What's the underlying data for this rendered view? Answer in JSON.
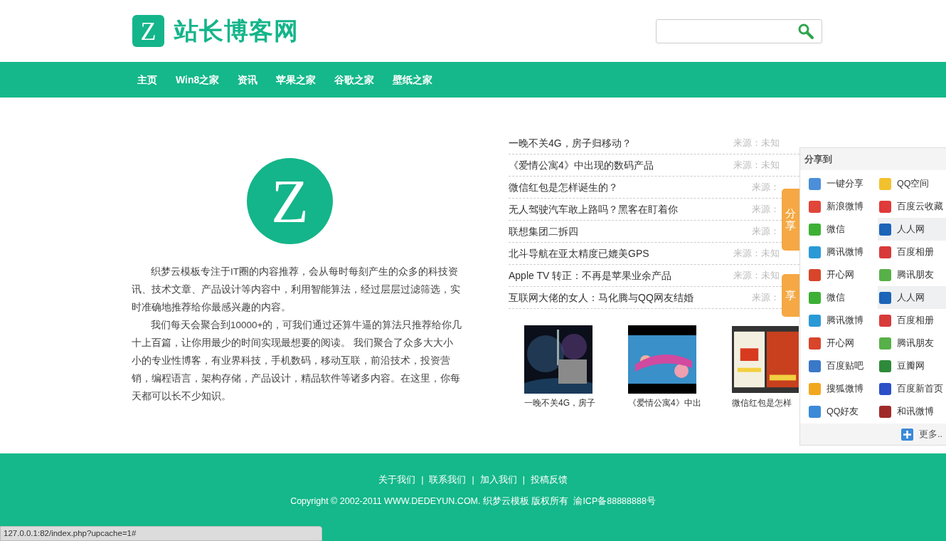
{
  "header": {
    "logo_letter": "Z",
    "site_name": "站长博客网"
  },
  "nav": [
    {
      "label": "主页"
    },
    {
      "label": "Win8之家"
    },
    {
      "label": "资讯"
    },
    {
      "label": "苹果之家"
    },
    {
      "label": "谷歌之家"
    },
    {
      "label": "壁纸之家"
    }
  ],
  "intro": {
    "logo_letter": "Z",
    "paragraphs": [
      "织梦云模板专注于IT圈的内容推荐，会从每时每刻产生的众多的科技资讯、技术文章、产品设计等内容中，利用智能算法，经过层层过滤筛选，实时准确地推荐给你最感兴趣的内容。",
      "我们每天会聚合到10000+的，可我们通过还算牛逼的算法只推荐给你几十上百篇，让你用最少的时间实现最想要的阅读。 我们聚合了众多大大小小的专业性博客，有业界科技，手机数码，移动互联，前沿技术，投资营销，编程语言，架构存储，产品设计，精品软件等诸多内容。在这里，你每天都可以长不少知识。"
    ]
  },
  "news": [
    {
      "title": "一晚不关4G，房子归移动？",
      "source": "来源：未知"
    },
    {
      "title": "《爱情公寓4》中出现的数码产品",
      "source": "来源：未知"
    },
    {
      "title": "微信红包是怎样诞生的？",
      "source": "来源："
    },
    {
      "title": "无人驾驶汽车敢上路吗？黑客在盯着你",
      "source": "来源："
    },
    {
      "title": "联想集团二拆四",
      "source": "来源："
    },
    {
      "title": "北斗导航在亚太精度已媲美GPS",
      "source": "来源：未知"
    },
    {
      "title": "Apple TV 转正：不再是苹果业余产品",
      "source": "来源：未知"
    },
    {
      "title": "互联网大佬的女人：马化腾与QQ网友结婚",
      "source": "来源："
    }
  ],
  "thumbs": [
    {
      "kind": "picture",
      "caption": "一晚不关4G，房子"
    },
    {
      "kind": "picture",
      "caption": "《爱情公寓4》中出"
    },
    {
      "kind": "picture",
      "caption": "微信红包是怎样"
    }
  ],
  "share_tabs": [
    {
      "label": "分享"
    },
    {
      "label": "享"
    }
  ],
  "share_panel": {
    "title": "分享到",
    "items": [
      {
        "label": "一键分享",
        "color": "#4a8fd8",
        "highlighted": false
      },
      {
        "label": "QQ空间",
        "color": "#f2c12e",
        "highlighted": false
      },
      {
        "label": "新浪微博",
        "color": "#e0463a",
        "highlighted": false
      },
      {
        "label": "百度云收藏",
        "color": "#e03a3a",
        "highlighted": false
      },
      {
        "label": "微信",
        "color": "#3cb034",
        "highlighted": false
      },
      {
        "label": "人人网",
        "color": "#1b64b8",
        "highlighted": true
      },
      {
        "label": "腾讯微博",
        "color": "#2a9ad6",
        "highlighted": false
      },
      {
        "label": "百度相册",
        "color": "#d83a3a",
        "highlighted": false
      },
      {
        "label": "开心网",
        "color": "#d8452a",
        "highlighted": false
      },
      {
        "label": "腾讯朋友",
        "color": "#58b048",
        "highlighted": false
      },
      {
        "label": "微信",
        "color": "#3cb034",
        "highlighted": false
      },
      {
        "label": "人人网",
        "color": "#1b64b8",
        "highlighted": true
      },
      {
        "label": "腾讯微博",
        "color": "#2a9ad6",
        "highlighted": false
      },
      {
        "label": "百度相册",
        "color": "#d83a3a",
        "highlighted": false
      },
      {
        "label": "开心网",
        "color": "#d8452a",
        "highlighted": false
      },
      {
        "label": "腾讯朋友",
        "color": "#58b048",
        "highlighted": false
      },
      {
        "label": "百度贴吧",
        "color": "#3a78c8",
        "highlighted": false
      },
      {
        "label": "豆瓣网",
        "color": "#2e8a3a",
        "highlighted": false
      },
      {
        "label": "搜狐微博",
        "color": "#f2a81e",
        "highlighted": false
      },
      {
        "label": "百度新首页",
        "color": "#2a4fc8",
        "highlighted": false
      },
      {
        "label": "QQ好友",
        "color": "#3a8ad8",
        "highlighted": false
      },
      {
        "label": "和讯微博",
        "color": "#a02a2a",
        "highlighted": false
      }
    ],
    "more": "更多.."
  },
  "footer": {
    "links": [
      "关于我们",
      "联系我们",
      "加入我们",
      "投稿反馈"
    ],
    "separator": "|",
    "copyright": "Copyright © 2002-2011 WWW.DEDEYUN.COM. 织梦云模板 版权所有  渝ICP备88888888号"
  },
  "status_bar": {
    "url": "127.0.0.1:82/index.php?upcache=1#"
  }
}
